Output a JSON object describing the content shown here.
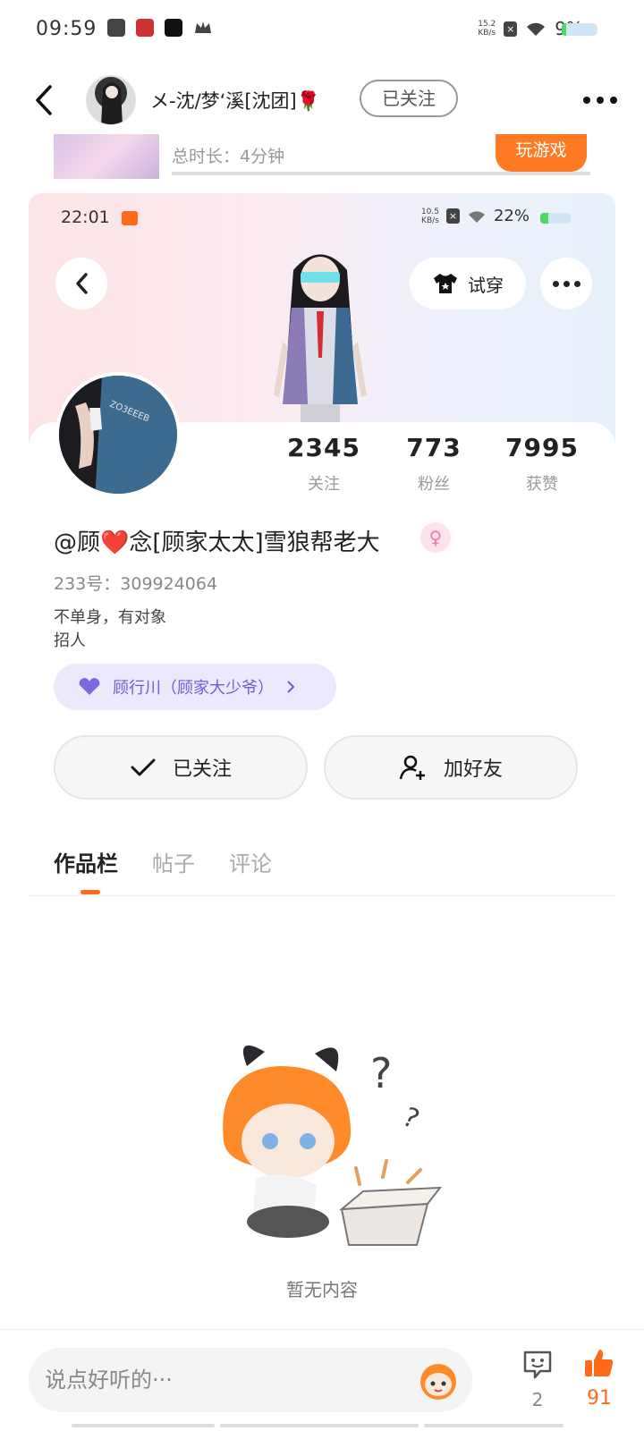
{
  "status_bar": {
    "time": "09:59",
    "net_speed_top": "15.2",
    "net_speed_unit": "KB/s",
    "battery": "9%"
  },
  "header": {
    "username": "メ-沈/梦‘溪[沈团]🌹",
    "follow_label": "已关注"
  },
  "partial_item": {
    "duration": "总时长：4分钟",
    "play_label": "玩游戏"
  },
  "embedded": {
    "time": "22:01",
    "app_badge": "233",
    "net_speed_top": "10.5",
    "net_speed_unit": "KB/s",
    "battery": "22%",
    "try_on_label": "试穿",
    "stats": [
      {
        "value": "2345",
        "label": "关注"
      },
      {
        "value": "773",
        "label": "粉丝"
      },
      {
        "value": "7995",
        "label": "获赞"
      }
    ],
    "display_name": "@顾❤️念[顾家太太]雪狼帮老大",
    "uid": "233号：309924064",
    "bio_line1": "不单身，有对象",
    "bio_line2": "招人",
    "cp_label": "顾行川（顾家大少爷）",
    "follow_button": "已关注",
    "add_friend_button": "加好友",
    "tabs": [
      "作品栏",
      "帖子",
      "评论"
    ],
    "empty_text": "暂无内容"
  },
  "bottom": {
    "comment_placeholder": "说点好听的···",
    "comment_count": "2",
    "like_count": "91"
  },
  "colors": {
    "accent": "#ff6a1a",
    "cp_purple": "#6a5ed8",
    "gender_pink": "#ef7aa4"
  }
}
